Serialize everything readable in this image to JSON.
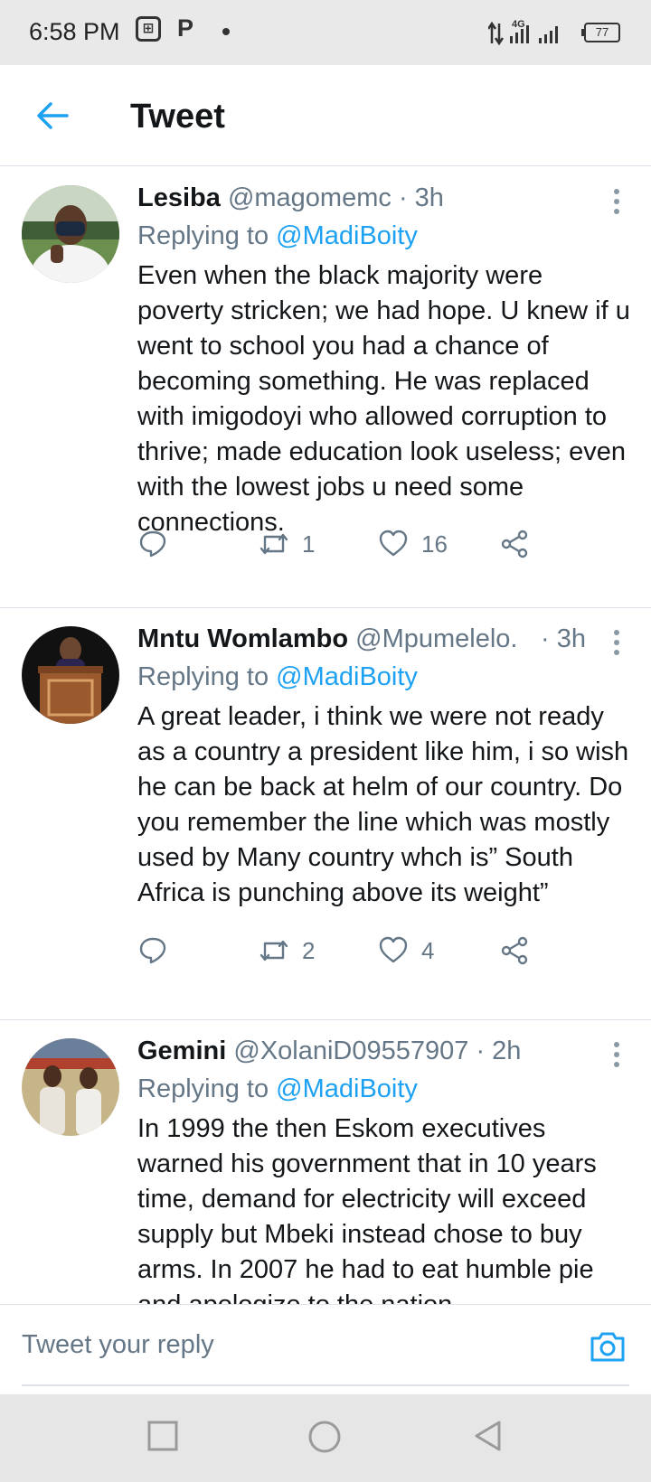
{
  "status": {
    "time": "6:58 PM",
    "network": "4G",
    "battery": "77"
  },
  "header": {
    "title": "Tweet"
  },
  "tweets": [
    {
      "name": "Lesiba",
      "handle": "@magomemc",
      "time": "· 3h",
      "replying_prefix": "Replying to",
      "replying_to": "@MadiBoity",
      "body": "Even when the black majority were poverty stricken; we had hope. U knew if u went to school you had a chance of becoming something. He was replaced with imigodoyi who allowed corruption to thrive; made education look useless; even with the lowest jobs u need some connections.",
      "retweets": "1",
      "likes": "16"
    },
    {
      "name": "Mntu Womlambo",
      "handle": "@Mpumelelo...",
      "time": "· 3h",
      "replying_prefix": "Replying to",
      "replying_to": "@MadiBoity",
      "body": "A great leader, i think we were not ready as a country a president like him, i so wish he can be back at helm of our country. Do you remember the line which was mostly used by Many country whch is” South Africa is punching above its weight”",
      "retweets": "2",
      "likes": "4"
    },
    {
      "name": "Gemini",
      "handle": "@XolaniD09557907",
      "time": "· 2h",
      "replying_prefix": "Replying to",
      "replying_to": "@MadiBoity",
      "body": "In 1999 the then Eskom executives warned his government that in 10 years time, demand for electricity  will exceed supply but Mbeki instead chose to buy arms. In 2007 he had to eat humble pie and apologize to the nation.",
      "retweets": "",
      "likes": ""
    }
  ],
  "reply": {
    "placeholder": "Tweet your reply"
  },
  "colors": {
    "accent": "#1da1f2",
    "muted": "#657786",
    "text": "#14171a",
    "divider": "#dde3e8"
  }
}
